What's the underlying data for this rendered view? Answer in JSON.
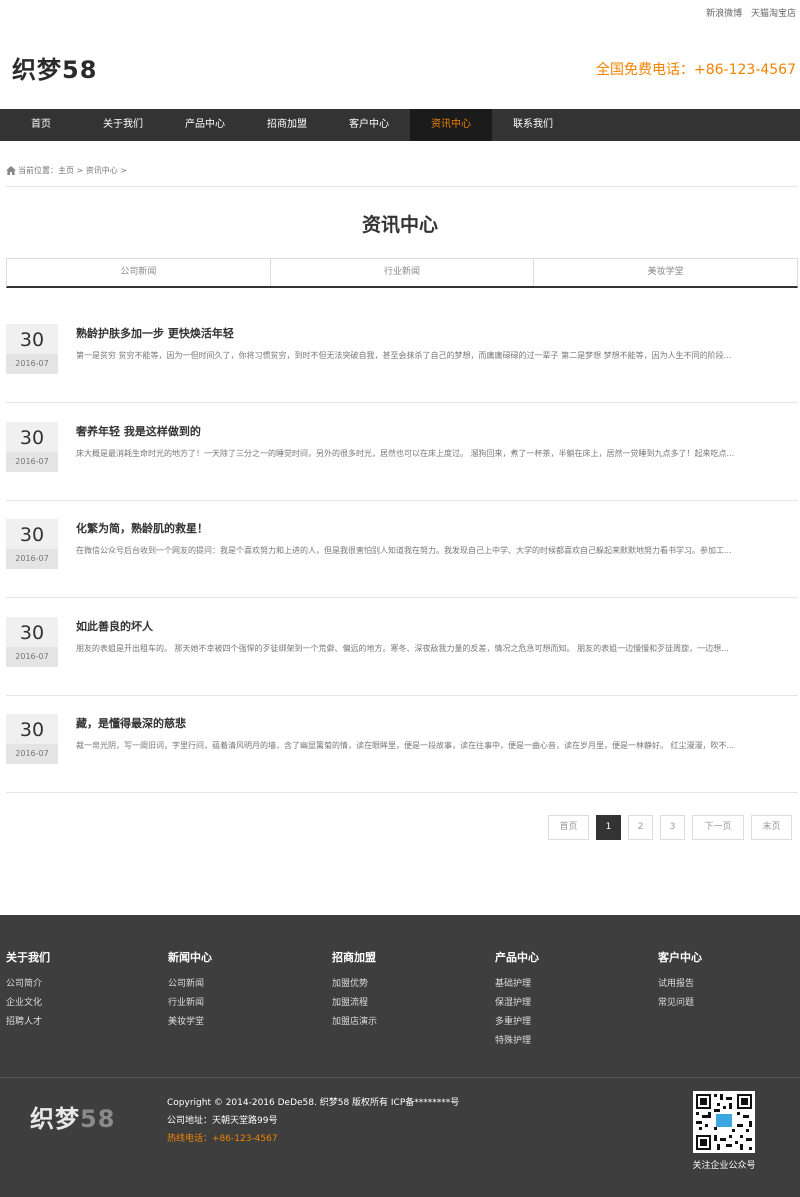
{
  "top_links": [
    "新浪微博",
    "天猫淘宝店"
  ],
  "header": {
    "logo": "织梦58",
    "hotline": "全国免费电话：+86-123-4567"
  },
  "nav": [
    "首页",
    "关于我们",
    "产品中心",
    "招商加盟",
    "客户中心",
    "资讯中心",
    "联系我们"
  ],
  "nav_active": "资讯中心",
  "breadcrumb": "当前位置：主页 > 资讯中心 >",
  "page_title": "资讯中心",
  "tabs": [
    "公司新闻",
    "行业新闻",
    "美妆学堂"
  ],
  "news": [
    {
      "day": "30",
      "month": "2016-07",
      "title": "熟龄护肤多加一步 更快焕活年轻",
      "summary": "第一是贫穷 贫穷不能等，因为一但时间久了，你将习惯贫穷，到时不但无法突破自我，甚至会抹杀了自己的梦想，而庸庸碌碌的过一辈子 第二是梦想 梦想不能等，因为人生不同的阶段..."
    },
    {
      "day": "30",
      "month": "2016-07",
      "title": "奢养年轻 我是这样做到的",
      "summary": "床大概是最消耗生命时光的地方了！一天除了三分之一的睡觉时间，另外的很多时光，居然也可以在床上度过。 溜狗回来，煮了一杯茶，半躺在床上，居然一觉睡到九点多了！起来吃点..."
    },
    {
      "day": "30",
      "month": "2016-07",
      "title": "化繁为简，熟龄肌的救星！",
      "summary": "在微信公众号后台收到一个网友的提问：我是个喜欢努力和上进的人，但是我很害怕别人知道我在努力。我发现自己上中学、大学的时候都喜欢自己躲起来默默地努力看书学习。参加工..."
    },
    {
      "day": "30",
      "month": "2016-07",
      "title": "如此善良的坏人",
      "summary": "朋友的表姐是开出租车的。 那天她不幸被四个强悍的歹徒绑架到一个荒僻、偏远的地方。寒冬、深夜敌我力量的反差，情况之危急可想而知。 朋友的表姐一边慢慢和歹徒周旋，一边想..."
    },
    {
      "day": "30",
      "month": "2016-07",
      "title": "藏，是懂得最深的慈悲",
      "summary": "裁一帛光阴，写一阕旧词，字里行间，蕴着清风明月的墙，含了幽显篱菊的情，读在眼眸里，便是一段故事，读在往事中，便是一曲心音，读在岁月里，便是一林静好。 红尘漫漫，吹不..."
    }
  ],
  "pagination": {
    "first": "首页",
    "pages": [
      "1",
      "2",
      "3"
    ],
    "current": "1",
    "next": "下一页",
    "last": "末页"
  },
  "footer": {
    "columns": [
      {
        "title": "关于我们",
        "links": [
          "公司简介",
          "企业文化",
          "招聘人才"
        ]
      },
      {
        "title": "新闻中心",
        "links": [
          "公司新闻",
          "行业新闻",
          "美妆学堂"
        ]
      },
      {
        "title": "招商加盟",
        "links": [
          "加盟优势",
          "加盟流程",
          "加盟店演示"
        ]
      },
      {
        "title": "产品中心",
        "links": [
          "基础护理",
          "保湿护理",
          "多重护理",
          "特殊护理"
        ]
      },
      {
        "title": "客户中心",
        "links": [
          "试用报告",
          "常见问题"
        ]
      }
    ],
    "logo_main": "织梦",
    "logo_num": "58",
    "copyright": "Copyright © 2014-2016 DeDe58. 织梦58 版权所有 ICP备********号",
    "address": "公司地址：天朝天堂路99号",
    "hotline": "热线电话：+86-123-4567",
    "qr_caption": "关注企业公众号"
  },
  "colors": {
    "accent": "#f08300",
    "nav_bg": "#333333",
    "footer_bg": "#3e3e3e"
  }
}
